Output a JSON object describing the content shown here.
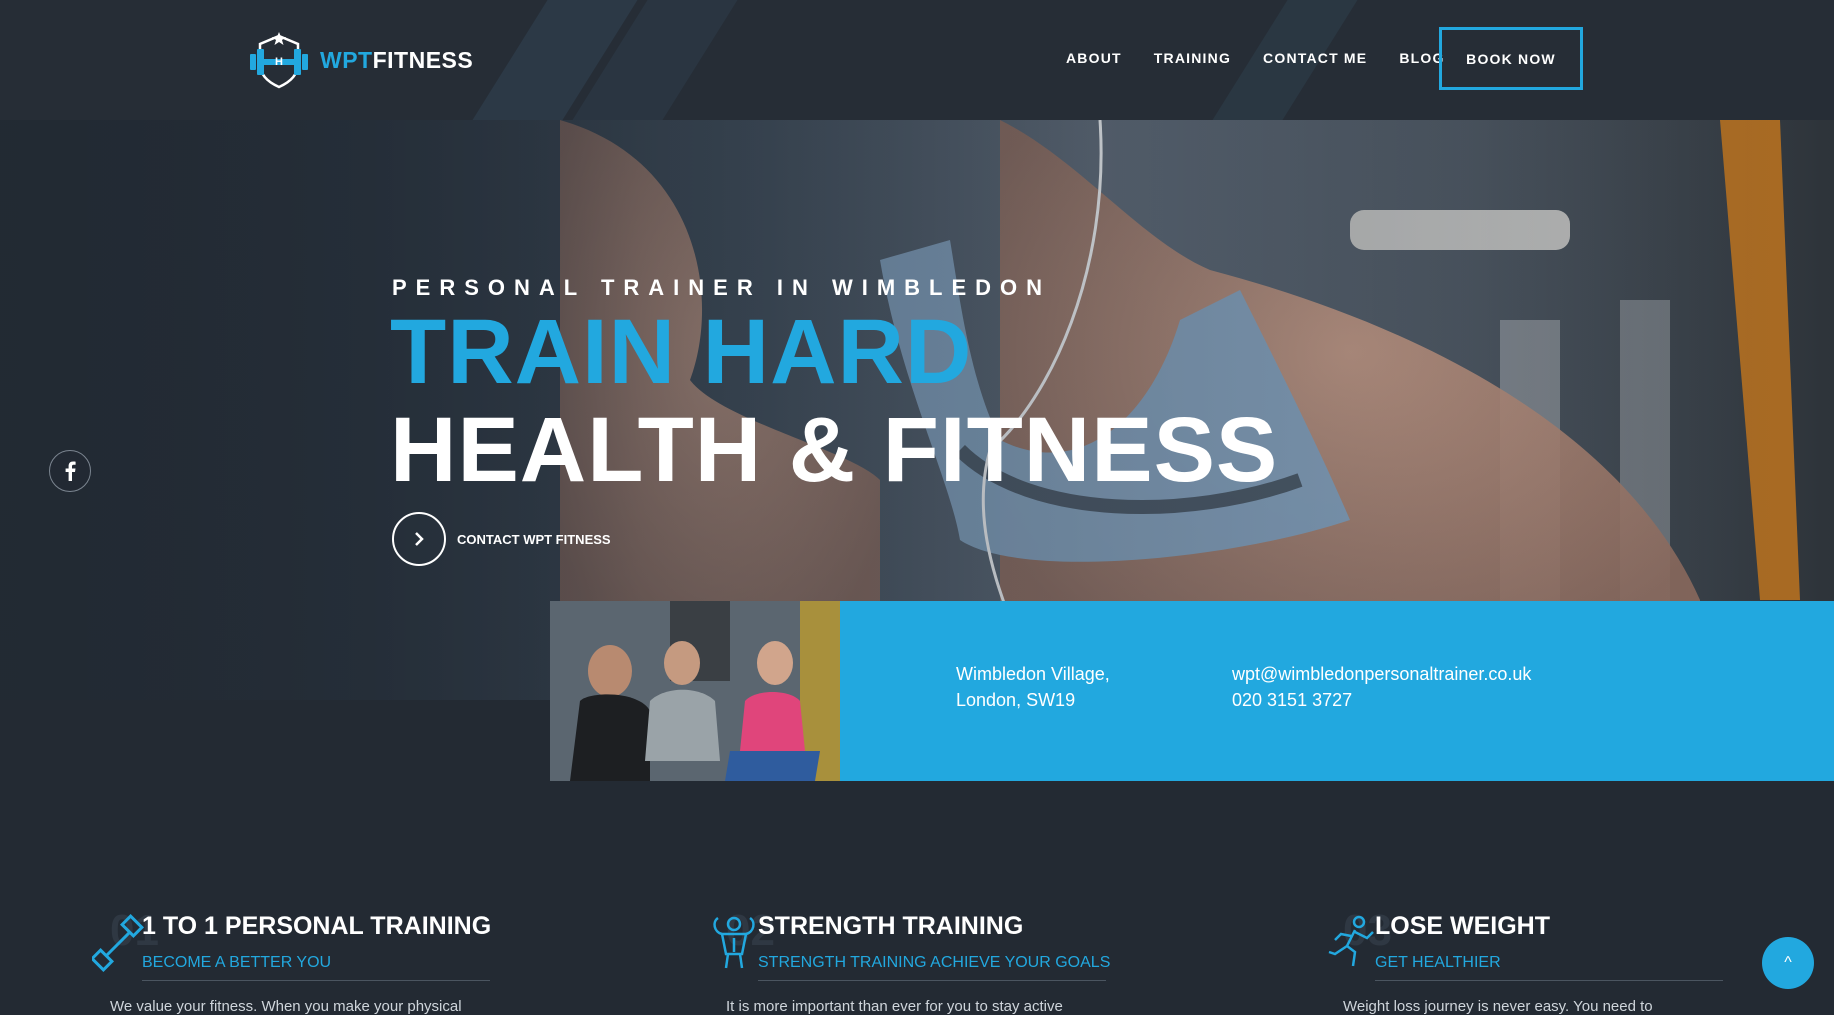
{
  "brand": {
    "part1": "WPT",
    "part2": "FITNESS",
    "accent": "#22a8df",
    "dark": "#232a33"
  },
  "nav": {
    "items": [
      {
        "label": "ABOUT"
      },
      {
        "label": "TRAINING"
      },
      {
        "label": "CONTACT ME"
      },
      {
        "label": "BLOG"
      }
    ],
    "book_label": "BOOK NOW"
  },
  "hero": {
    "subtitle": "PERSONAL TRAINER IN WIMBLEDON",
    "title_line1": "TRAIN HARD",
    "title_line2": "HEALTH & FITNESS",
    "cta_label": "CONTACT WPT FITNESS"
  },
  "social": {
    "facebook_icon": "facebook-icon"
  },
  "info": {
    "address_line1": "Wimbledon Village,",
    "address_line2": "London, SW19",
    "email": "wpt@wimbledonpersonaltrainer.co.uk",
    "phone": "020 3151 3727"
  },
  "services": [
    {
      "num": "01",
      "icon": "dumbbell-icon",
      "title": "1 TO 1 PERSONAL TRAINING",
      "tagline": "BECOME A BETTER YOU",
      "desc": "We value your fitness. When you make your physical"
    },
    {
      "num": "02",
      "icon": "muscle-man-icon",
      "title": "STRENGTH TRAINING",
      "tagline": "STRENGTH TRAINING ACHIEVE YOUR GOALS",
      "desc": "It is more important than ever for you to stay active"
    },
    {
      "num": "03",
      "icon": "running-man-icon",
      "title": "LOSE WEIGHT",
      "tagline": "GET HEALTHIER",
      "desc": "Weight loss journey is never easy. You need to"
    }
  ],
  "back_to_top": {
    "label": "^"
  }
}
